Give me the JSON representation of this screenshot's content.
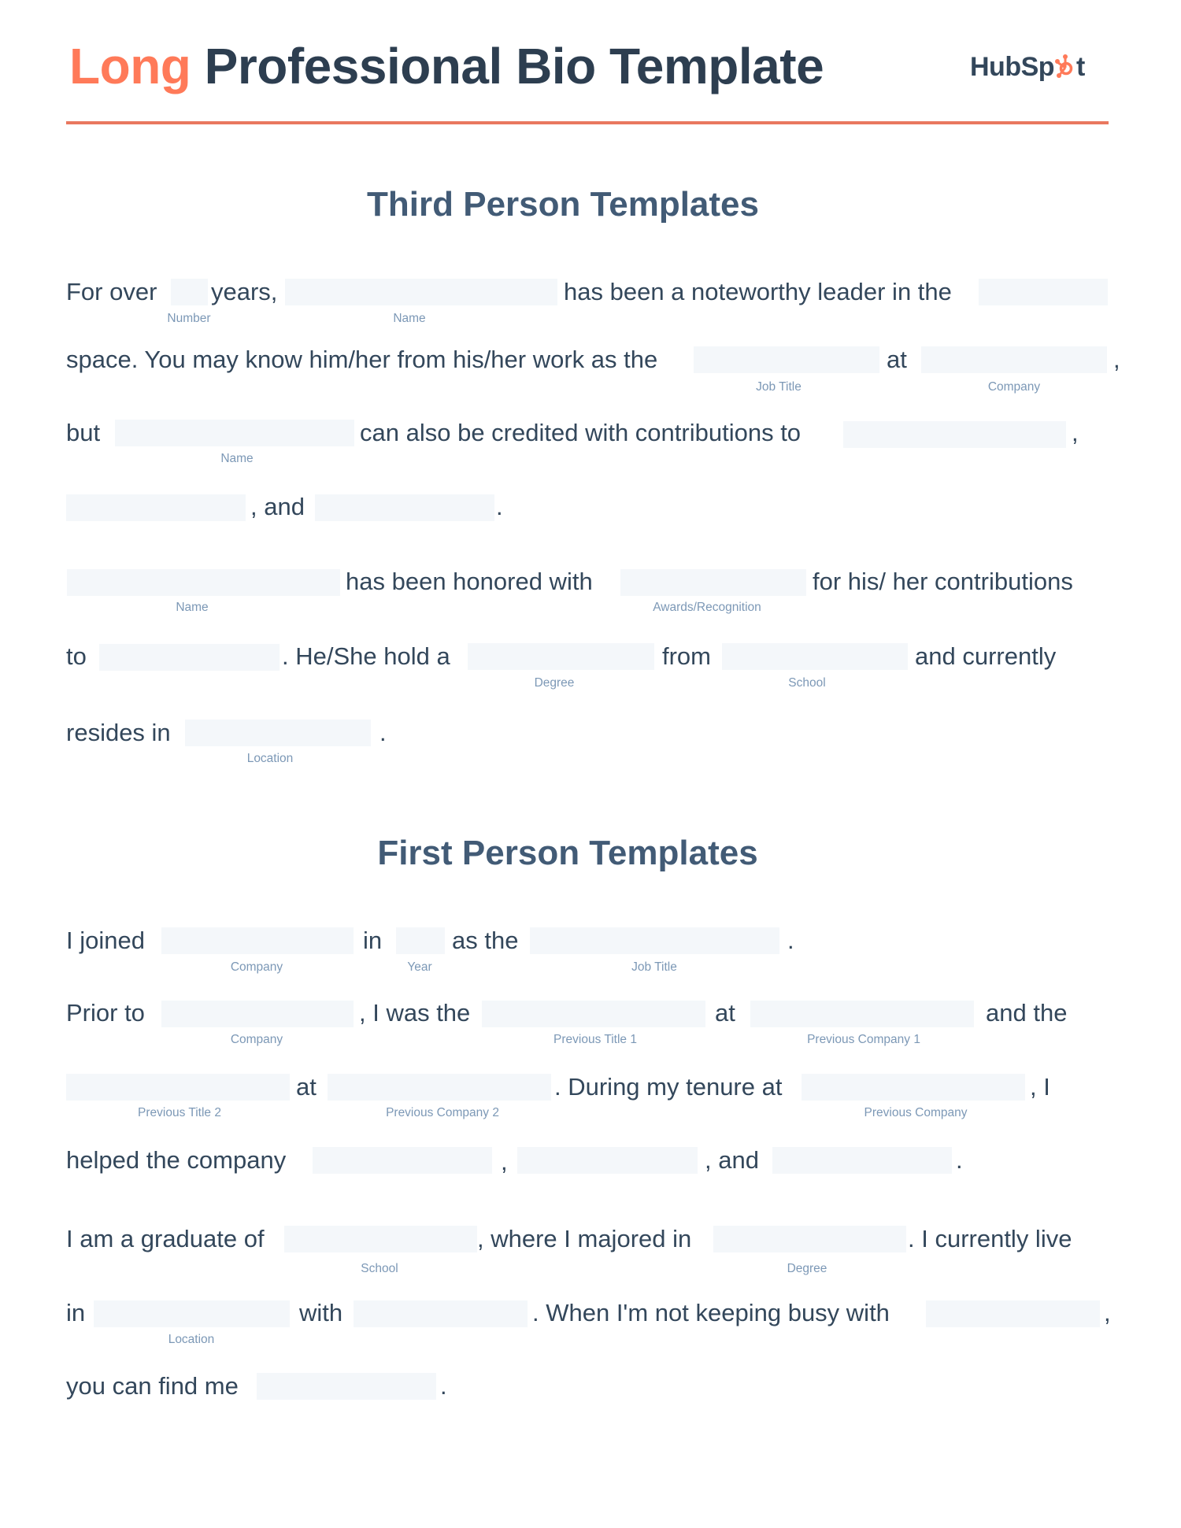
{
  "header": {
    "title_accent": "Long",
    "title_rest": "Professional Bio Template",
    "logo_text_a": "HubSp",
    "logo_text_b": "t",
    "logo_icon": "sprocket-icon",
    "colors": {
      "accent": "#ff7a59",
      "heading": "#2d3e50",
      "section": "#425b76",
      "field": "#f4f7fa",
      "label": "#7c98b6"
    }
  },
  "third_person": {
    "heading": "Third Person Templates",
    "text": {
      "t1": "For over",
      "t2": "years,",
      "t3": "has been a noteworthy leader in the",
      "t4": "space. You may know him/her from his/her work as the",
      "t5": "at",
      "t6": ",",
      "t7": "but",
      "t8": "can also be credited with contributions to",
      "t9": ",",
      "t10": ", and",
      "t11": ".",
      "t12": "has been honored with",
      "t13": "for his/ her contributions",
      "t14": "to",
      "t15": ". He/She hold a",
      "t16": "from",
      "t17": "and currently",
      "t18": "resides in",
      "t19": "."
    },
    "labels": {
      "number": "Number",
      "name1": "Name",
      "job_title": "Job Title",
      "company": "Company",
      "name2": "Name",
      "name3": "Name",
      "awards": "Awards/Recognition",
      "degree": "Degree",
      "school": "School",
      "location": "Location"
    }
  },
  "first_person": {
    "heading": "First Person Templates",
    "text": {
      "t1": "I joined",
      "t2": "in",
      "t3": "as the",
      "t4": ".",
      "t5": "Prior to",
      "t6": ", I was the",
      "t7": "at",
      "t8": "and the",
      "t9": "at",
      "t10": ". During my tenure at",
      "t11": ", I",
      "t12": "helped the company",
      "t13": ",",
      "t14": ", and",
      "t15": ".",
      "t16": "I am a graduate of",
      "t17": ", where I majored in",
      "t18": ". I currently live",
      "t19": "in",
      "t20": "with",
      "t21": ".  When I'm not keeping busy with",
      "t22": ",",
      "t23": "you can find me",
      "t24": "."
    },
    "labels": {
      "company1": "Company",
      "year": "Year",
      "job_title": "Job Title",
      "company2": "Company",
      "prev_title1": "Previous Title 1",
      "prev_company1": "Previous Company 1",
      "prev_title2": "Previous Title 2",
      "prev_company2": "Previous Company 2",
      "prev_company": "Previous Company",
      "school": "School",
      "degree": "Degree",
      "location": "Location"
    }
  }
}
